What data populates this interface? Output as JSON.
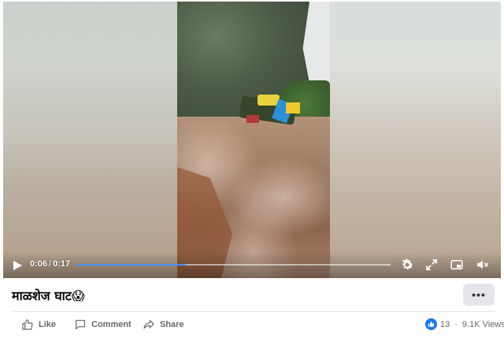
{
  "video": {
    "current_time": "0:06",
    "time_separator": "/",
    "duration": "0:17",
    "progress_fraction": 0.35,
    "accent_color": "#4a8ff5",
    "controls": {
      "play_icon": "play-icon",
      "settings_icon": "gear-icon",
      "fullscreen_icon": "expand-icon",
      "pip_icon": "picture-in-picture-icon",
      "volume_icon": "volume-muted-icon"
    }
  },
  "post": {
    "title": "माळशेज घाट😱",
    "more_label": "•••"
  },
  "actions": {
    "like_label": "Like",
    "comment_label": "Comment",
    "share_label": "Share"
  },
  "stats": {
    "reaction_count": "13",
    "separator": "·",
    "views": "9.1K Views",
    "reaction_color": "#1877f2"
  }
}
